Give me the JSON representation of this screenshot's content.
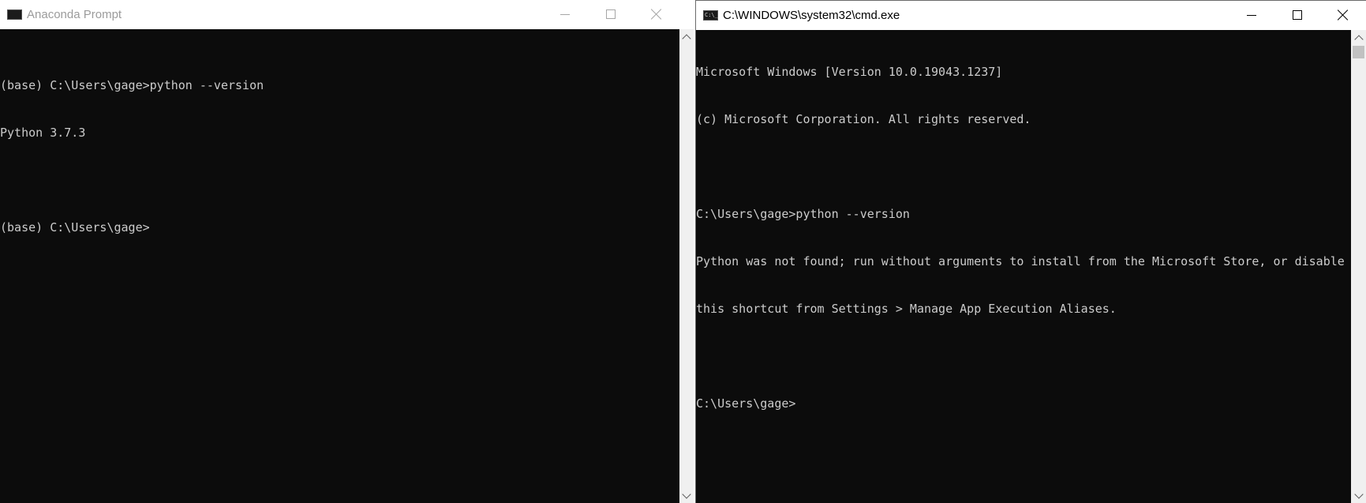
{
  "left_window": {
    "title": "Anaconda Prompt",
    "lines": [
      "(base) C:\\Users\\gage>python --version",
      "Python 3.7.3",
      "",
      "(base) C:\\Users\\gage>"
    ]
  },
  "right_window": {
    "title": "C:\\WINDOWS\\system32\\cmd.exe",
    "lines": [
      "Microsoft Windows [Version 10.0.19043.1237]",
      "(c) Microsoft Corporation. All rights reserved.",
      "",
      "C:\\Users\\gage>python --version",
      "Python was not found; run without arguments to install from the Microsoft Store, or disable",
      "this shortcut from Settings > Manage App Execution Aliases.",
      "",
      "C:\\Users\\gage>"
    ]
  },
  "colors": {
    "console_bg": "#0c0c0c",
    "console_fg": "#cccccc",
    "titlebar_bg": "#ffffff",
    "inactive_title": "#9b9b9b"
  },
  "icons": {
    "left_app_icon": "console-window-icon",
    "right_app_icon": "cmd-icon",
    "minimize": "minimize-icon",
    "maximize": "maximize-icon",
    "close": "close-icon"
  }
}
